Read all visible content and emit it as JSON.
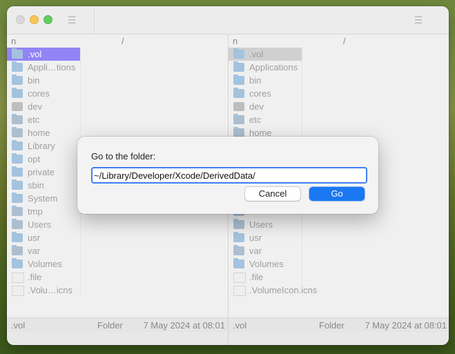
{
  "window": {
    "traffic_lights": {
      "close": "#d0d0d0",
      "minimize": "#f6b731",
      "maximize": "#3fc23f"
    },
    "toolbar_left_icon": "list-icon",
    "toolbar_right_icon": "list-icon"
  },
  "left_pane": {
    "header_name": "n",
    "header_path": "/",
    "items": [
      {
        "label": ".vol",
        "icon": "folder-icon",
        "selected": true
      },
      {
        "label": "Appli…tions",
        "icon": "folder-icon"
      },
      {
        "label": "bin",
        "icon": "folder-icon"
      },
      {
        "label": "cores",
        "icon": "folder-icon"
      },
      {
        "label": "dev",
        "icon": "disk-icon"
      },
      {
        "label": "etc",
        "icon": "folder-alias-icon"
      },
      {
        "label": "home",
        "icon": "network-icon"
      },
      {
        "label": "Library",
        "icon": "folder-icon"
      },
      {
        "label": "opt",
        "icon": "folder-icon"
      },
      {
        "label": "private",
        "icon": "folder-icon"
      },
      {
        "label": "sbin",
        "icon": "folder-icon"
      },
      {
        "label": "System",
        "icon": "folder-icon"
      },
      {
        "label": "tmp",
        "icon": "folder-alias-icon"
      },
      {
        "label": "Users",
        "icon": "users-folder-icon"
      },
      {
        "label": "usr",
        "icon": "folder-icon"
      },
      {
        "label": "var",
        "icon": "folder-alias-icon"
      },
      {
        "label": "Volumes",
        "icon": "folder-icon"
      },
      {
        "label": ".file",
        "icon": "document-icon"
      },
      {
        "label": ".Volu…icns",
        "icon": "document-icon"
      }
    ],
    "status": {
      "name": ".vol",
      "kind": "Folder",
      "date": "7 May 2024 at 08:01"
    }
  },
  "right_pane": {
    "header_name": "n",
    "header_path": "/",
    "items": [
      {
        "label": ".vol",
        "icon": "folder-icon",
        "selected": true
      },
      {
        "label": "Applications",
        "icon": "folder-icon"
      },
      {
        "label": "bin",
        "icon": "folder-icon"
      },
      {
        "label": "cores",
        "icon": "folder-icon"
      },
      {
        "label": "dev",
        "icon": "disk-icon"
      },
      {
        "label": "etc",
        "icon": "folder-alias-icon"
      },
      {
        "label": "home",
        "icon": "network-icon"
      },
      {
        "label": "",
        "icon": "folder-icon"
      },
      {
        "label": "",
        "icon": "folder-icon"
      },
      {
        "label": "",
        "icon": "folder-icon"
      },
      {
        "label": "",
        "icon": "folder-icon"
      },
      {
        "label": "",
        "icon": "folder-icon"
      },
      {
        "label": "",
        "icon": "folder-alias-icon"
      },
      {
        "label": "Users",
        "icon": "users-folder-icon"
      },
      {
        "label": "usr",
        "icon": "folder-icon"
      },
      {
        "label": "var",
        "icon": "folder-alias-icon"
      },
      {
        "label": "Volumes",
        "icon": "folder-icon"
      },
      {
        "label": ".file",
        "icon": "document-icon"
      },
      {
        "label": ".VolumeIcon.icns",
        "icon": "document-icon"
      }
    ],
    "status": {
      "name": ".vol",
      "kind": "Folder",
      "date": "7 May 2024 at 08:01"
    }
  },
  "dialog": {
    "title": "Go to the folder:",
    "path_value": "~/Library/Developer/Xcode/DerivedData/",
    "cancel_label": "Cancel",
    "go_label": "Go",
    "accent_color": "#1a78f2"
  }
}
